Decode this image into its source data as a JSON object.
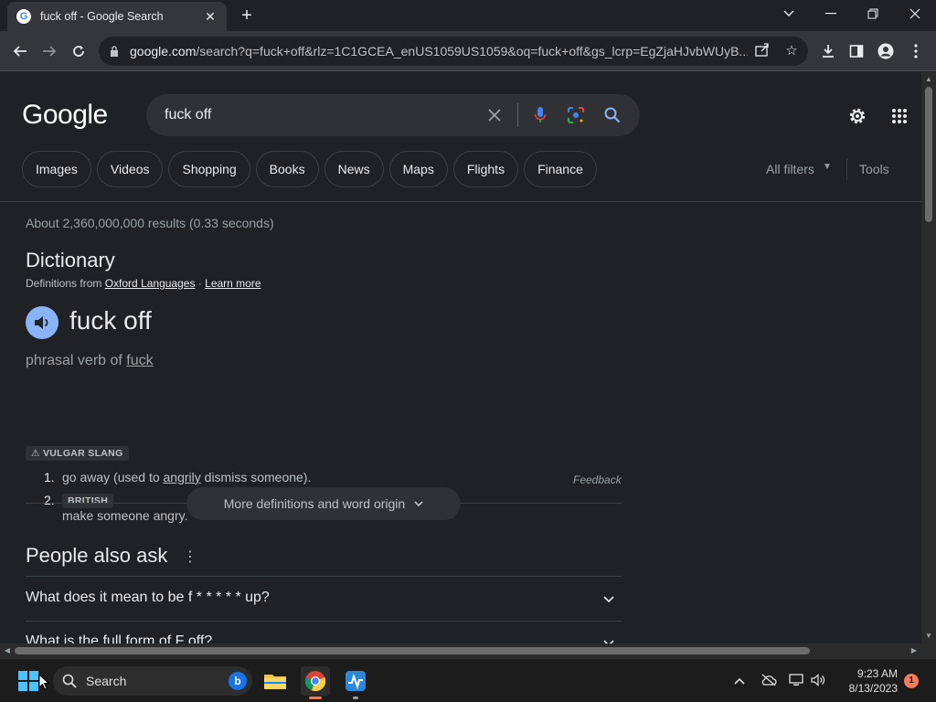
{
  "browser": {
    "tab_title": "fuck off - Google Search",
    "url_domain": "google.com",
    "url_path": "/search?q=fuck+off&rlz=1C1GCEA_enUS1059US1059&oq=fuck+off&gs_lcrp=EgZjaHJvbWUyB..."
  },
  "search": {
    "logo": "Google",
    "query": "fuck off",
    "chips": [
      "Images",
      "Videos",
      "Shopping",
      "Books",
      "News",
      "Maps",
      "Flights",
      "Finance"
    ],
    "all_filters": "All filters",
    "tools": "Tools",
    "stats": "About 2,360,000,000 results (0.33 seconds)"
  },
  "dictionary": {
    "title": "Dictionary",
    "source_prefix": "Definitions from",
    "source_name": "Oxford Languages",
    "source_sep": "·",
    "learn_more": "Learn more",
    "word": "fuck off",
    "pos_prefix": "phrasal verb of",
    "pos_link": "fuck",
    "register_label": "VULGAR SLANG",
    "definitions": [
      {
        "num": "1.",
        "before": "go away (used to",
        "link": "angrily",
        "after": "dismiss someone)."
      },
      {
        "num": "2.",
        "tag": "BRITISH",
        "text": "make someone angry."
      }
    ],
    "feedback": "Feedback",
    "more_button": "More definitions and word origin"
  },
  "people_also_ask": {
    "title": "People also ask",
    "questions": [
      "What does it mean to be f * * * * * up?",
      "What is the full form of F off?"
    ]
  },
  "taskbar": {
    "search_label": "Search",
    "time": "9:23 AM",
    "date": "8/13/2023",
    "notification_count": "1"
  },
  "colors": {
    "page_bg": "#202124",
    "accent_blue": "#8ab4f8",
    "windows_blue": "#4cc2ff"
  }
}
